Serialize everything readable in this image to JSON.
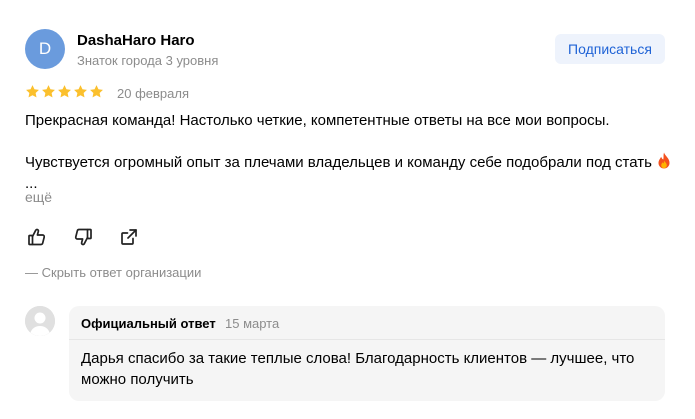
{
  "author": {
    "avatar_letter": "D",
    "avatar_color": "#6a9bdd",
    "name": "DashaHaro Haro",
    "level": "Знаток города 3 уровня"
  },
  "subscribe_label": "Подписаться",
  "rating": {
    "value": 5,
    "max": 5,
    "star_color": "#fbc02d"
  },
  "review": {
    "date": "20 февраля",
    "paragraph1": "Прекрасная команда! Настолько четкие, компетентные ответы на все мои вопросы.",
    "paragraph2": "Чувствуется огромный опыт за плечами владельцев и команду себе подобрали под стать",
    "ellipsis": "...",
    "more_label": "ещё"
  },
  "actions": [
    {
      "icon": "like-icon"
    },
    {
      "icon": "dislike-icon"
    },
    {
      "icon": "share-icon"
    }
  ],
  "hide_reply_label": "— Скрыть ответ организации",
  "official_reply": {
    "title": "Официальный ответ",
    "date": "15 марта",
    "text": "Дарья спасибо за такие теплые слова! Благодарность клиентов — лучшее, что можно получить"
  },
  "colors": {
    "accent": "#1f63d6",
    "muted_text": "#8c8c8c",
    "card_bg": "#f5f5f5"
  }
}
